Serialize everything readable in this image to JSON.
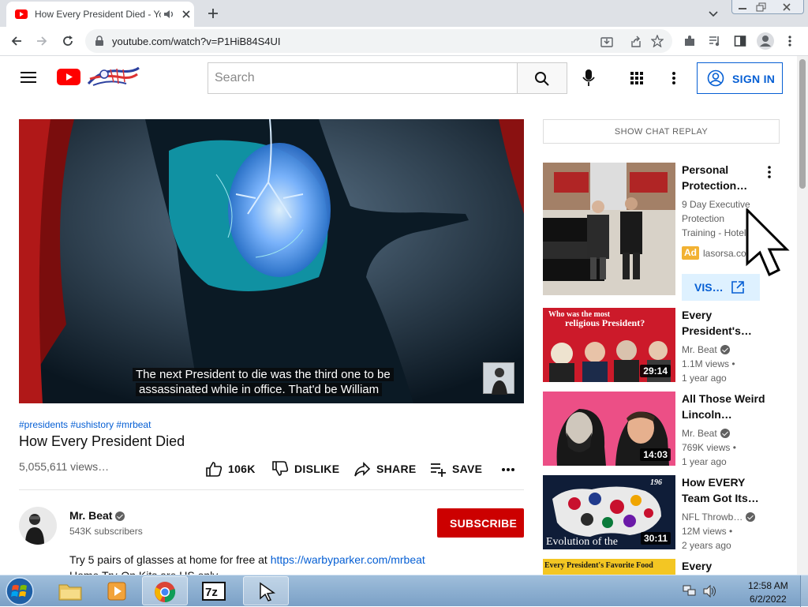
{
  "browser": {
    "tab_title": "How Every President Died - YouTube",
    "url": "youtube.com/watch?v=P1HiB84S4UI"
  },
  "header": {
    "search_placeholder": "Search",
    "sign_in_label": "SIGN IN"
  },
  "player": {
    "caption_line1": "The next President to die was the third one to be",
    "caption_line2": "assassinated while in office. That'd be William"
  },
  "video": {
    "hashtags": "#presidents #ushistory #mrbeat",
    "title": "How Every President Died",
    "views": "5,055,611 views…",
    "like_count": "106K",
    "dislike_label": "DISLIKE",
    "share_label": "SHARE",
    "save_label": "SAVE"
  },
  "channel": {
    "name": "Mr. Beat",
    "subscribers": "543K subscribers",
    "subscribe_label": "SUBSCRIBE"
  },
  "description": {
    "line1_text": "Try 5 pairs of glasses at home for free at ",
    "line1_link": "https://warbyparker.com/mrbeat",
    "line2_text": "Home Try-On Kits are US only."
  },
  "sidebar": {
    "chat_replay_label": "SHOW CHAT REPLAY",
    "ad": {
      "title_line1": "Personal",
      "title_line2": "Protection…",
      "desc_line1": "9 Day Executive",
      "desc_line2": "Protection",
      "desc_line3": "Training - Hotel",
      "badge": "Ad",
      "domain": "lasorsa.co",
      "visit_label": "VIS…"
    },
    "videos": [
      {
        "title_line1": "Every",
        "title_line2": "President's…",
        "channel": "Mr. Beat",
        "views": "1.1M views •",
        "age": "1 year ago",
        "duration": "29:14",
        "thumb_text_line1": "Who was the most",
        "thumb_text_line2": "religious President?"
      },
      {
        "title_line1": "All Those Weird",
        "title_line2": "Lincoln…",
        "channel": "Mr. Beat",
        "views": "769K views •",
        "age": "1 year ago",
        "duration": "14:03"
      },
      {
        "title_line1": "How EVERY",
        "title_line2": "Team Got Its…",
        "channel": "NFL Throwb…",
        "views": "12M views •",
        "age": "2 years ago",
        "duration": "30:11",
        "thumb_text": "Evolution of the",
        "thumb_corner": "196"
      },
      {
        "title_line1": "Every",
        "thumb_text": "Every President's Favorite Food"
      }
    ]
  },
  "taskbar": {
    "time": "12:58 AM",
    "date": "6/2/2022"
  },
  "colors": {
    "yt_red": "#ff0000",
    "link_blue": "#065fd4",
    "subscribe_red": "#cc0000",
    "ad_yellow": "#f2b233"
  }
}
